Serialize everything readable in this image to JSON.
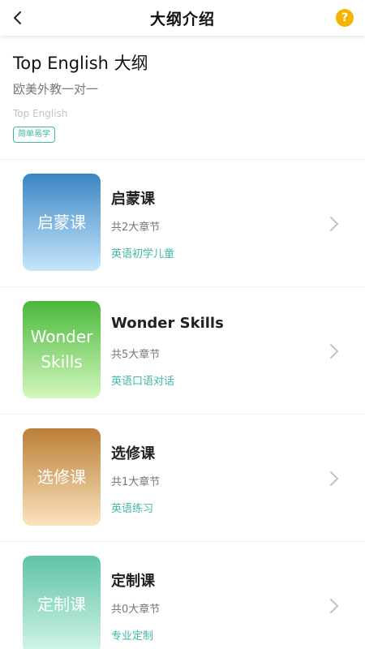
{
  "nav": {
    "title": "大纲介绍",
    "back_icon": "chevron-left-icon",
    "help_icon": "question-circle-icon",
    "help_glyph": "?",
    "help_color": "#f5b400"
  },
  "header": {
    "title": "Top English 大纲",
    "subtitle": "欧美外教一对一",
    "brand": "Top English",
    "tag": "简单易学"
  },
  "accent_color": "#3fb8a5",
  "courses": [
    {
      "thumb_text": "启蒙课",
      "name": "启蒙课",
      "chapters": "共2大章节",
      "desc": "英语初学儿童",
      "gradient": [
        "#3b86c4",
        "#c6e6fb"
      ]
    },
    {
      "thumb_text": "Wonder Skills",
      "name": "Wonder Skills",
      "chapters": "共5大章节",
      "desc": "英语口语对话",
      "gradient": [
        "#4ab83c",
        "#d4f8bd"
      ]
    },
    {
      "thumb_text": "选修课",
      "name": "选修课",
      "chapters": "共1大章节",
      "desc": "英语练习",
      "gradient": [
        "#bb7f37",
        "#fbe3bd"
      ]
    },
    {
      "thumb_text": "定制课",
      "name": "定制课",
      "chapters": "共0大章节",
      "desc": "专业定制",
      "gradient": [
        "#5fc3a6",
        "#d3f5ea"
      ]
    }
  ]
}
